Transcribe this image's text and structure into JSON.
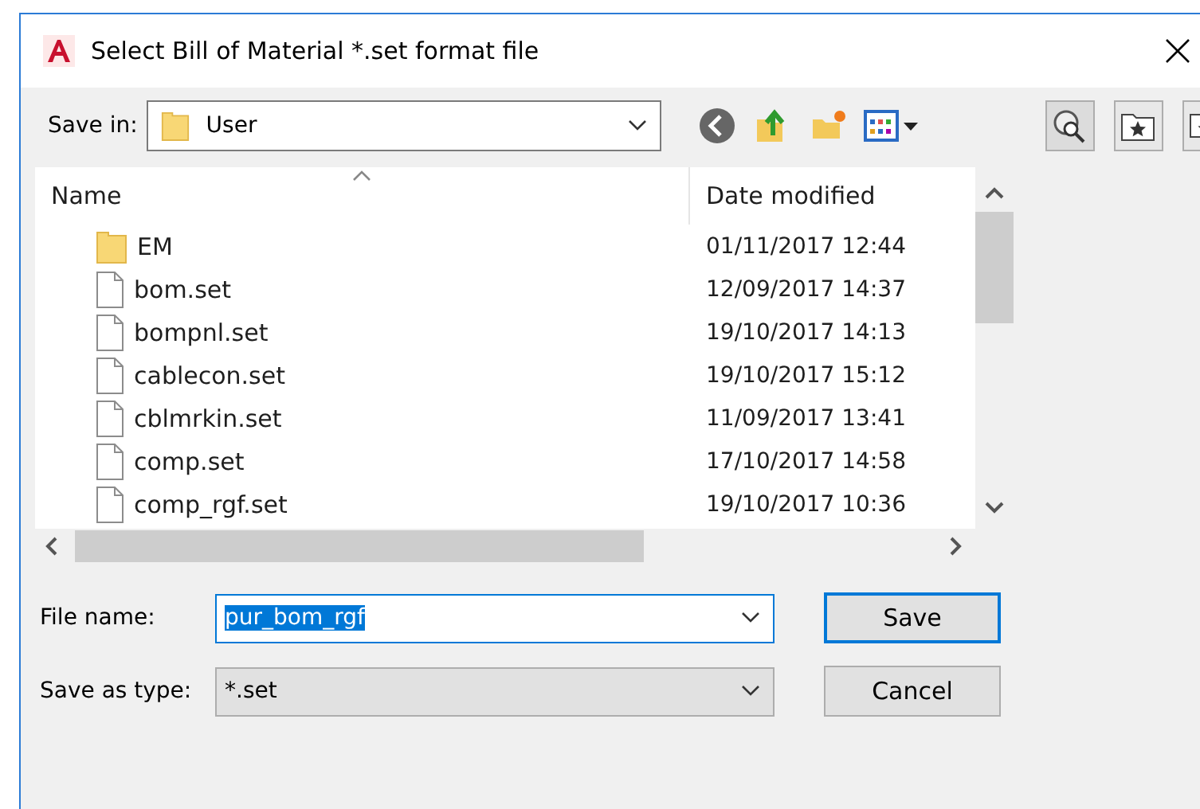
{
  "window": {
    "title": "Select Bill of Material *.set format file"
  },
  "save_in": {
    "label": "Save in:",
    "value": "User"
  },
  "file_list": {
    "columns": [
      {
        "label": "Name",
        "sorted": true
      },
      {
        "label": "Date modified",
        "sorted": false
      }
    ],
    "rows": [
      {
        "kind": "folder",
        "name": "EM",
        "date": "01/11/2017 12:44"
      },
      {
        "kind": "file",
        "name": "bom.set",
        "date": "12/09/2017 14:37"
      },
      {
        "kind": "file",
        "name": "bompnl.set",
        "date": "19/10/2017 14:13"
      },
      {
        "kind": "file",
        "name": "cablecon.set",
        "date": "19/10/2017 15:12"
      },
      {
        "kind": "file",
        "name": "cblmrkin.set",
        "date": "11/09/2017 13:41"
      },
      {
        "kind": "file",
        "name": "comp.set",
        "date": "17/10/2017 14:58"
      },
      {
        "kind": "file",
        "name": "comp_rgf.set",
        "date": "19/10/2017 10:36"
      }
    ]
  },
  "file_name": {
    "label": "File name:",
    "value": "pur_bom_rgf",
    "value_selected": true
  },
  "save_as_type": {
    "label": "Save as type:",
    "value": "*.set"
  },
  "buttons": [
    {
      "label": "Save",
      "default": true
    },
    {
      "label": "Cancel",
      "default": false
    }
  ]
}
